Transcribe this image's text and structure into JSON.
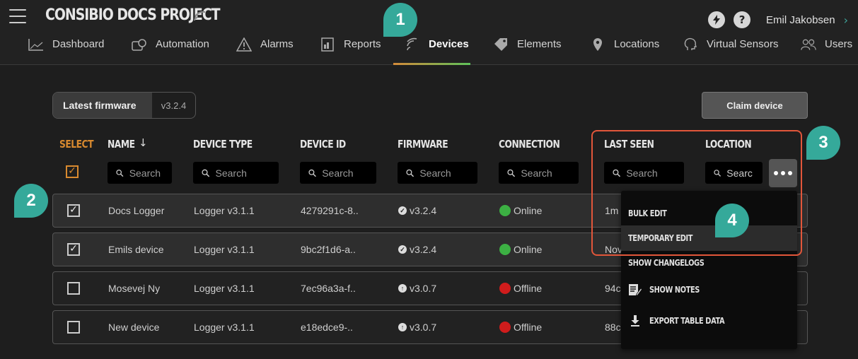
{
  "header": {
    "project_title": "CONSIBIO DOCS PROJECT",
    "user_name": "Emil Jakobsen",
    "flash_icon": "flash-icon",
    "help_label": "?"
  },
  "nav": {
    "items": [
      {
        "label": "Dashboard",
        "icon": "chart-line-icon"
      },
      {
        "label": "Automation",
        "icon": "automation-icon"
      },
      {
        "label": "Alarms",
        "icon": "warning-triangle-icon"
      },
      {
        "label": "Reports",
        "icon": "report-icon"
      },
      {
        "label": "Devices",
        "icon": "wireless-icon",
        "active": true
      },
      {
        "label": "Elements",
        "icon": "tag-icon"
      },
      {
        "label": "Locations",
        "icon": "map-pin-icon"
      },
      {
        "label": "Virtual Sensors",
        "icon": "brain-icon"
      },
      {
        "label": "Users",
        "icon": "users-icon"
      }
    ]
  },
  "callouts": [
    "1",
    "2",
    "3",
    "4"
  ],
  "firmware": {
    "label": "Latest firmware",
    "value": "v3.2.4"
  },
  "claim_button": "Claim device",
  "columns": {
    "select": "SELECT",
    "name": "NAME",
    "sort_arrow": "↓",
    "device_type": "DEVICE TYPE",
    "device_id": "DEVICE ID",
    "firmware": "FIRMWARE",
    "connection": "CONNECTION",
    "last_seen": "LAST SEEN",
    "location": "LOCATION"
  },
  "search": {
    "placeholder": "Search",
    "location_value": "Searc"
  },
  "check_mark": "✓",
  "rows": [
    {
      "name": "Docs Logger",
      "type": "Logger v3.1.1",
      "id": "4279291c-8..",
      "fw": "v3.2.4",
      "fw_icon": "✓",
      "conn": "Online",
      "last_seen": "1m",
      "checked": true
    },
    {
      "name": "Emils device",
      "type": "Logger v3.1.1",
      "id": "9bc2f1d6-a..",
      "fw": "v3.2.4",
      "fw_icon": "✓",
      "conn": "Online",
      "last_seen": "Nov",
      "checked": true
    },
    {
      "name": "Mosevej Ny",
      "type": "Logger v3.1.1",
      "id": "7ec96a3a-f..",
      "fw": "v3.0.7",
      "fw_icon": "↑",
      "conn": "Offline",
      "last_seen": "94c",
      "checked": false
    },
    {
      "name": "New device",
      "type": "Logger v3.1.1",
      "id": "e18edce9-..",
      "fw": "v3.0.7",
      "fw_icon": "↑",
      "conn": "Offline",
      "last_seen": "88c",
      "checked": false
    }
  ],
  "colors": {
    "online": "#3cb043",
    "offline": "#d01c1c",
    "accent": "#35a99a",
    "select": "#d98a2f",
    "highlight": "#e2563a"
  },
  "menu": {
    "items": [
      {
        "label": "BULK EDIT"
      },
      {
        "label": "TEMPORARY EDIT"
      },
      {
        "label": "SHOW CHANGELOGS"
      },
      {
        "label": "SHOW NOTES",
        "icon": "notes-icon"
      },
      {
        "label": "EXPORT TABLE DATA",
        "icon": "download-icon"
      }
    ]
  }
}
